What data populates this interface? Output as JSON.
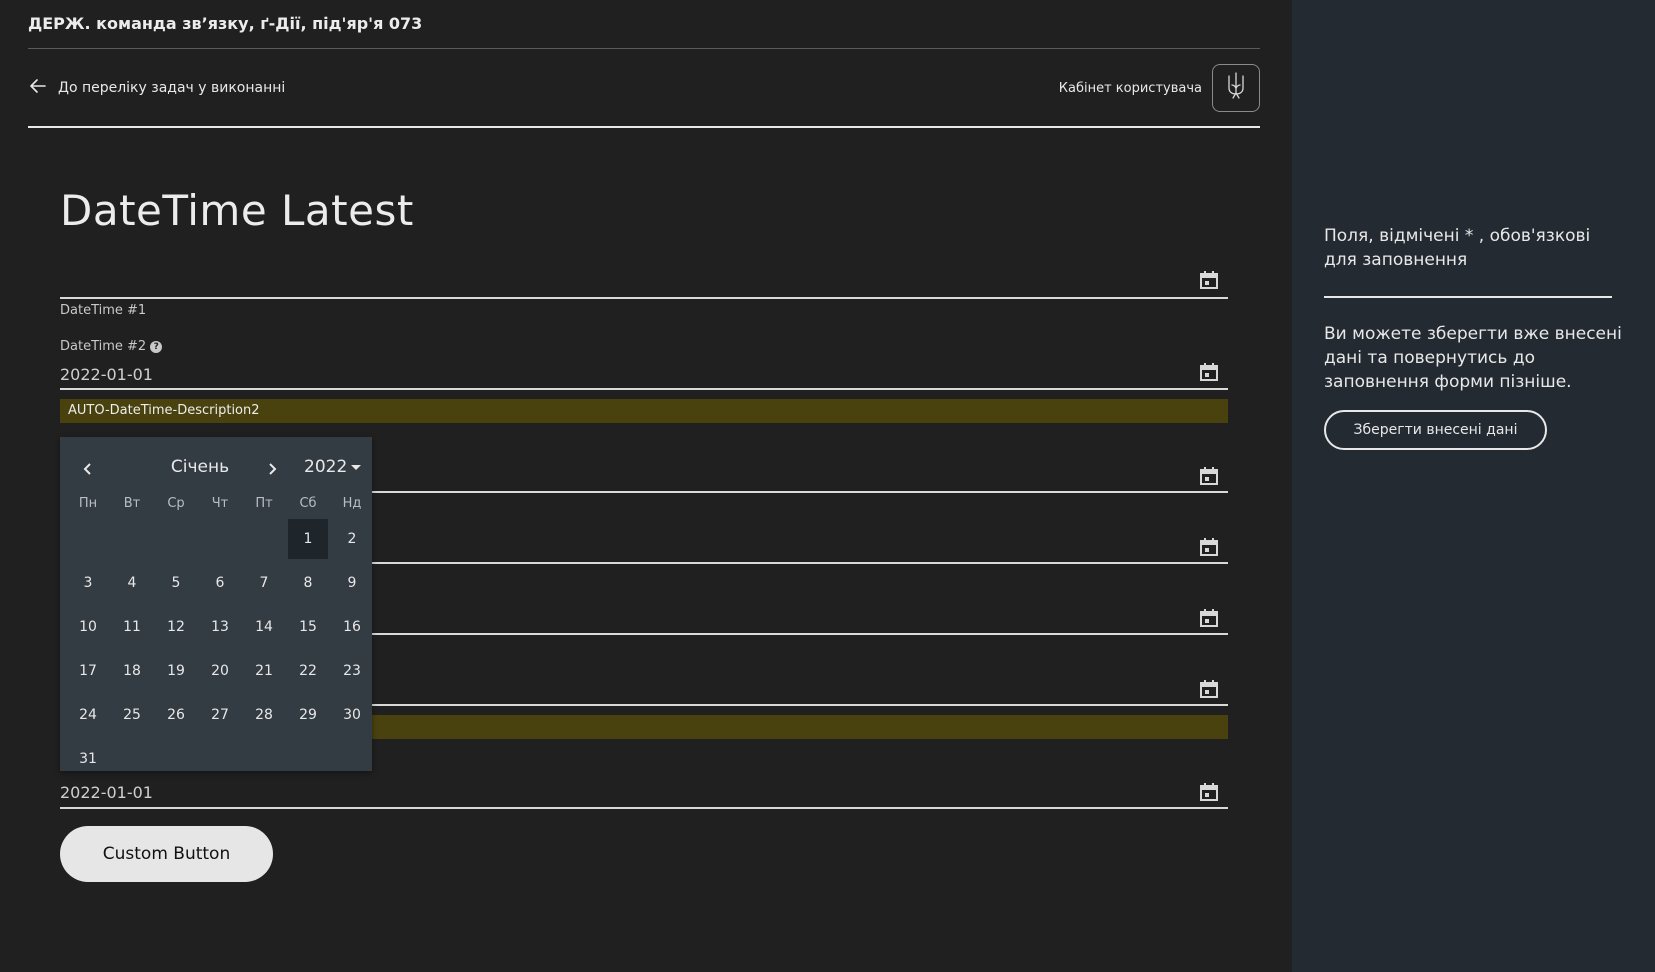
{
  "header": {
    "org_title": "ДЕРЖ. команда зв’язку, ґ-Дії, під'яр'я 073",
    "back_link": "До переліку задач у виконанні",
    "cabinet_label": "Кабінет користувача"
  },
  "form": {
    "title": "DateTime Latest",
    "fields": [
      {
        "label": "DateTime #1",
        "value": ""
      },
      {
        "label": "DateTime #2",
        "value": "2022-01-01",
        "description": "AUTO-DateTime-Description2"
      },
      {
        "label": "",
        "value": ""
      },
      {
        "label": "",
        "value": ""
      },
      {
        "label": "",
        "value": ""
      },
      {
        "label": "",
        "value": ""
      },
      {
        "label": "",
        "value": "2022-01-01"
      }
    ],
    "custom_button": "Custom Button"
  },
  "datepicker": {
    "month": "Січень",
    "year": "2022",
    "weekdays": [
      "Пн",
      "Вт",
      "Ср",
      "Чт",
      "Пт",
      "Сб",
      "Нд"
    ],
    "leading_blanks": 5,
    "days": [
      "1",
      "2",
      "3",
      "4",
      "5",
      "6",
      "7",
      "8",
      "9",
      "10",
      "11",
      "12",
      "13",
      "14",
      "15",
      "16",
      "17",
      "18",
      "19",
      "20",
      "21",
      "22",
      "23",
      "24",
      "25",
      "26",
      "27",
      "28",
      "29",
      "30",
      "31"
    ],
    "selected": "1"
  },
  "aside": {
    "required_note": "Поля, відмічені * , обов'язкові для заповнення",
    "save_hint": "Ви можете зберегти вже внесені дані та повернутись до заповнення форми пізніше.",
    "save_button": "Зберегти внесені дані"
  }
}
